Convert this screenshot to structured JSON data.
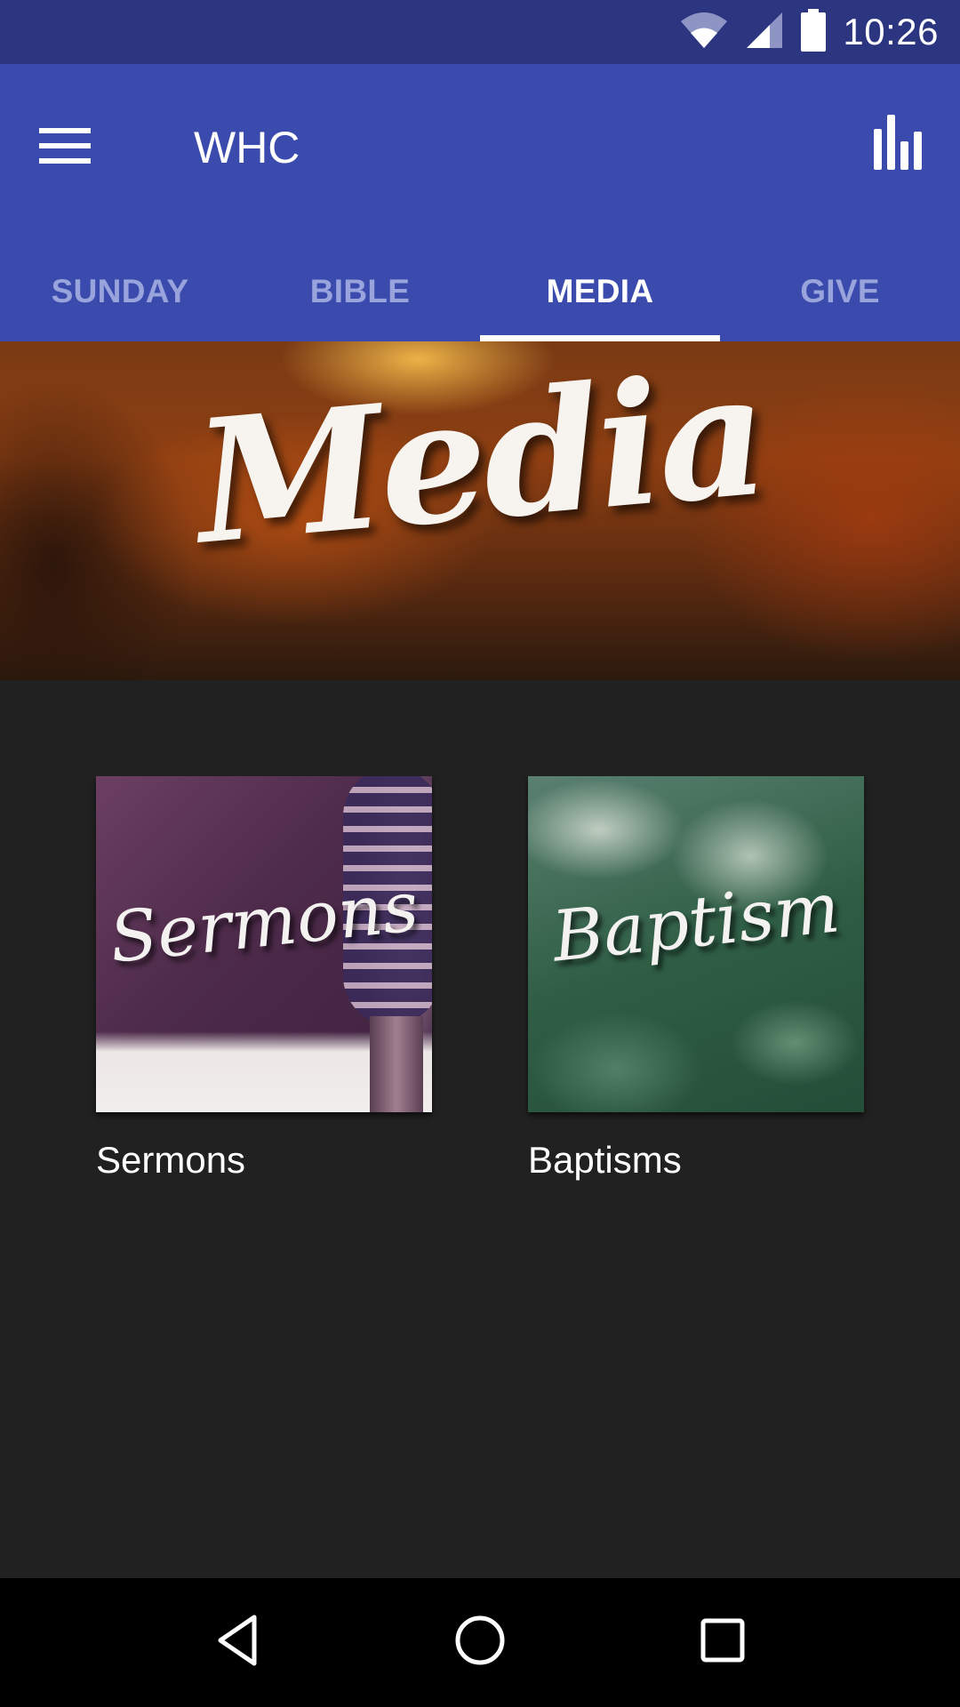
{
  "status_bar": {
    "time": "10:26",
    "icons": [
      "wifi-icon",
      "cellular-signal-icon",
      "battery-icon"
    ]
  },
  "app_bar": {
    "title": "WHC",
    "menu_icon": "hamburger-menu-icon",
    "action_icon": "bar-chart-icon"
  },
  "tabs": [
    {
      "label": "SUNDAY",
      "active": false
    },
    {
      "label": "BIBLE",
      "active": false
    },
    {
      "label": "MEDIA",
      "active": true
    },
    {
      "label": "GIVE",
      "active": false
    }
  ],
  "hero": {
    "title": "Media"
  },
  "cards": [
    {
      "thumbnail_text": "Sermons",
      "label": "Sermons"
    },
    {
      "thumbnail_text": "Baptism",
      "label": "Baptisms"
    }
  ],
  "nav_bar": {
    "icons": [
      "back-icon",
      "home-icon",
      "recents-icon"
    ]
  },
  "colors": {
    "status_bar": "#2c3580",
    "primary": "#3a4bad",
    "tab_inactive": "#9aa4dc",
    "tab_active": "#ffffff",
    "background": "#212121",
    "nav_bar": "#000000"
  }
}
